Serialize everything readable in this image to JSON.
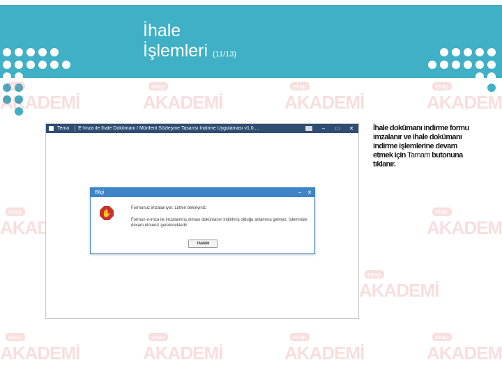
{
  "slide": {
    "title_line1": "İhale",
    "title_line2": "İşlemleri",
    "title_counter": "(11/13)"
  },
  "colors": {
    "banner": "#3fb0c6",
    "app_titlebar": "#2f4d73",
    "dialog_accent": "#3f84c6",
    "stop_icon": "#c9302c",
    "watermark": "#d83a3a"
  },
  "watermark": {
    "badge": "ekap",
    "text": "AKADEMİ"
  },
  "app_window": {
    "brand": "Tema",
    "title": "E-İmza ile İhale Dokümanı / Münferit Sözleşme Tasarısı İndirme Uygulaması v1.0....",
    "minimize": "–",
    "maximize": "□",
    "close": "✕"
  },
  "dialog": {
    "title": "Bilgi",
    "minimize": "–",
    "close": "✕",
    "icon": "stop-hand-icon",
    "message1": "Formunuz imzalanıyor. Lütfen bekleyiniz.",
    "message2": "Formun e-imza ile imzalanmış olması dokümanın indirilmiş olduğu anlamına gelmez. İşleminize devam etmeniz gerekmektedir.",
    "ok_label": "TAMAM"
  },
  "instruction": {
    "part1": "İhale dokümanı indirme formu imzalanır ve ihale dokümanı indirme işlemlerine devam etmek için ",
    "part2": "Tamam",
    "part3": " butonuna tıklanır."
  }
}
